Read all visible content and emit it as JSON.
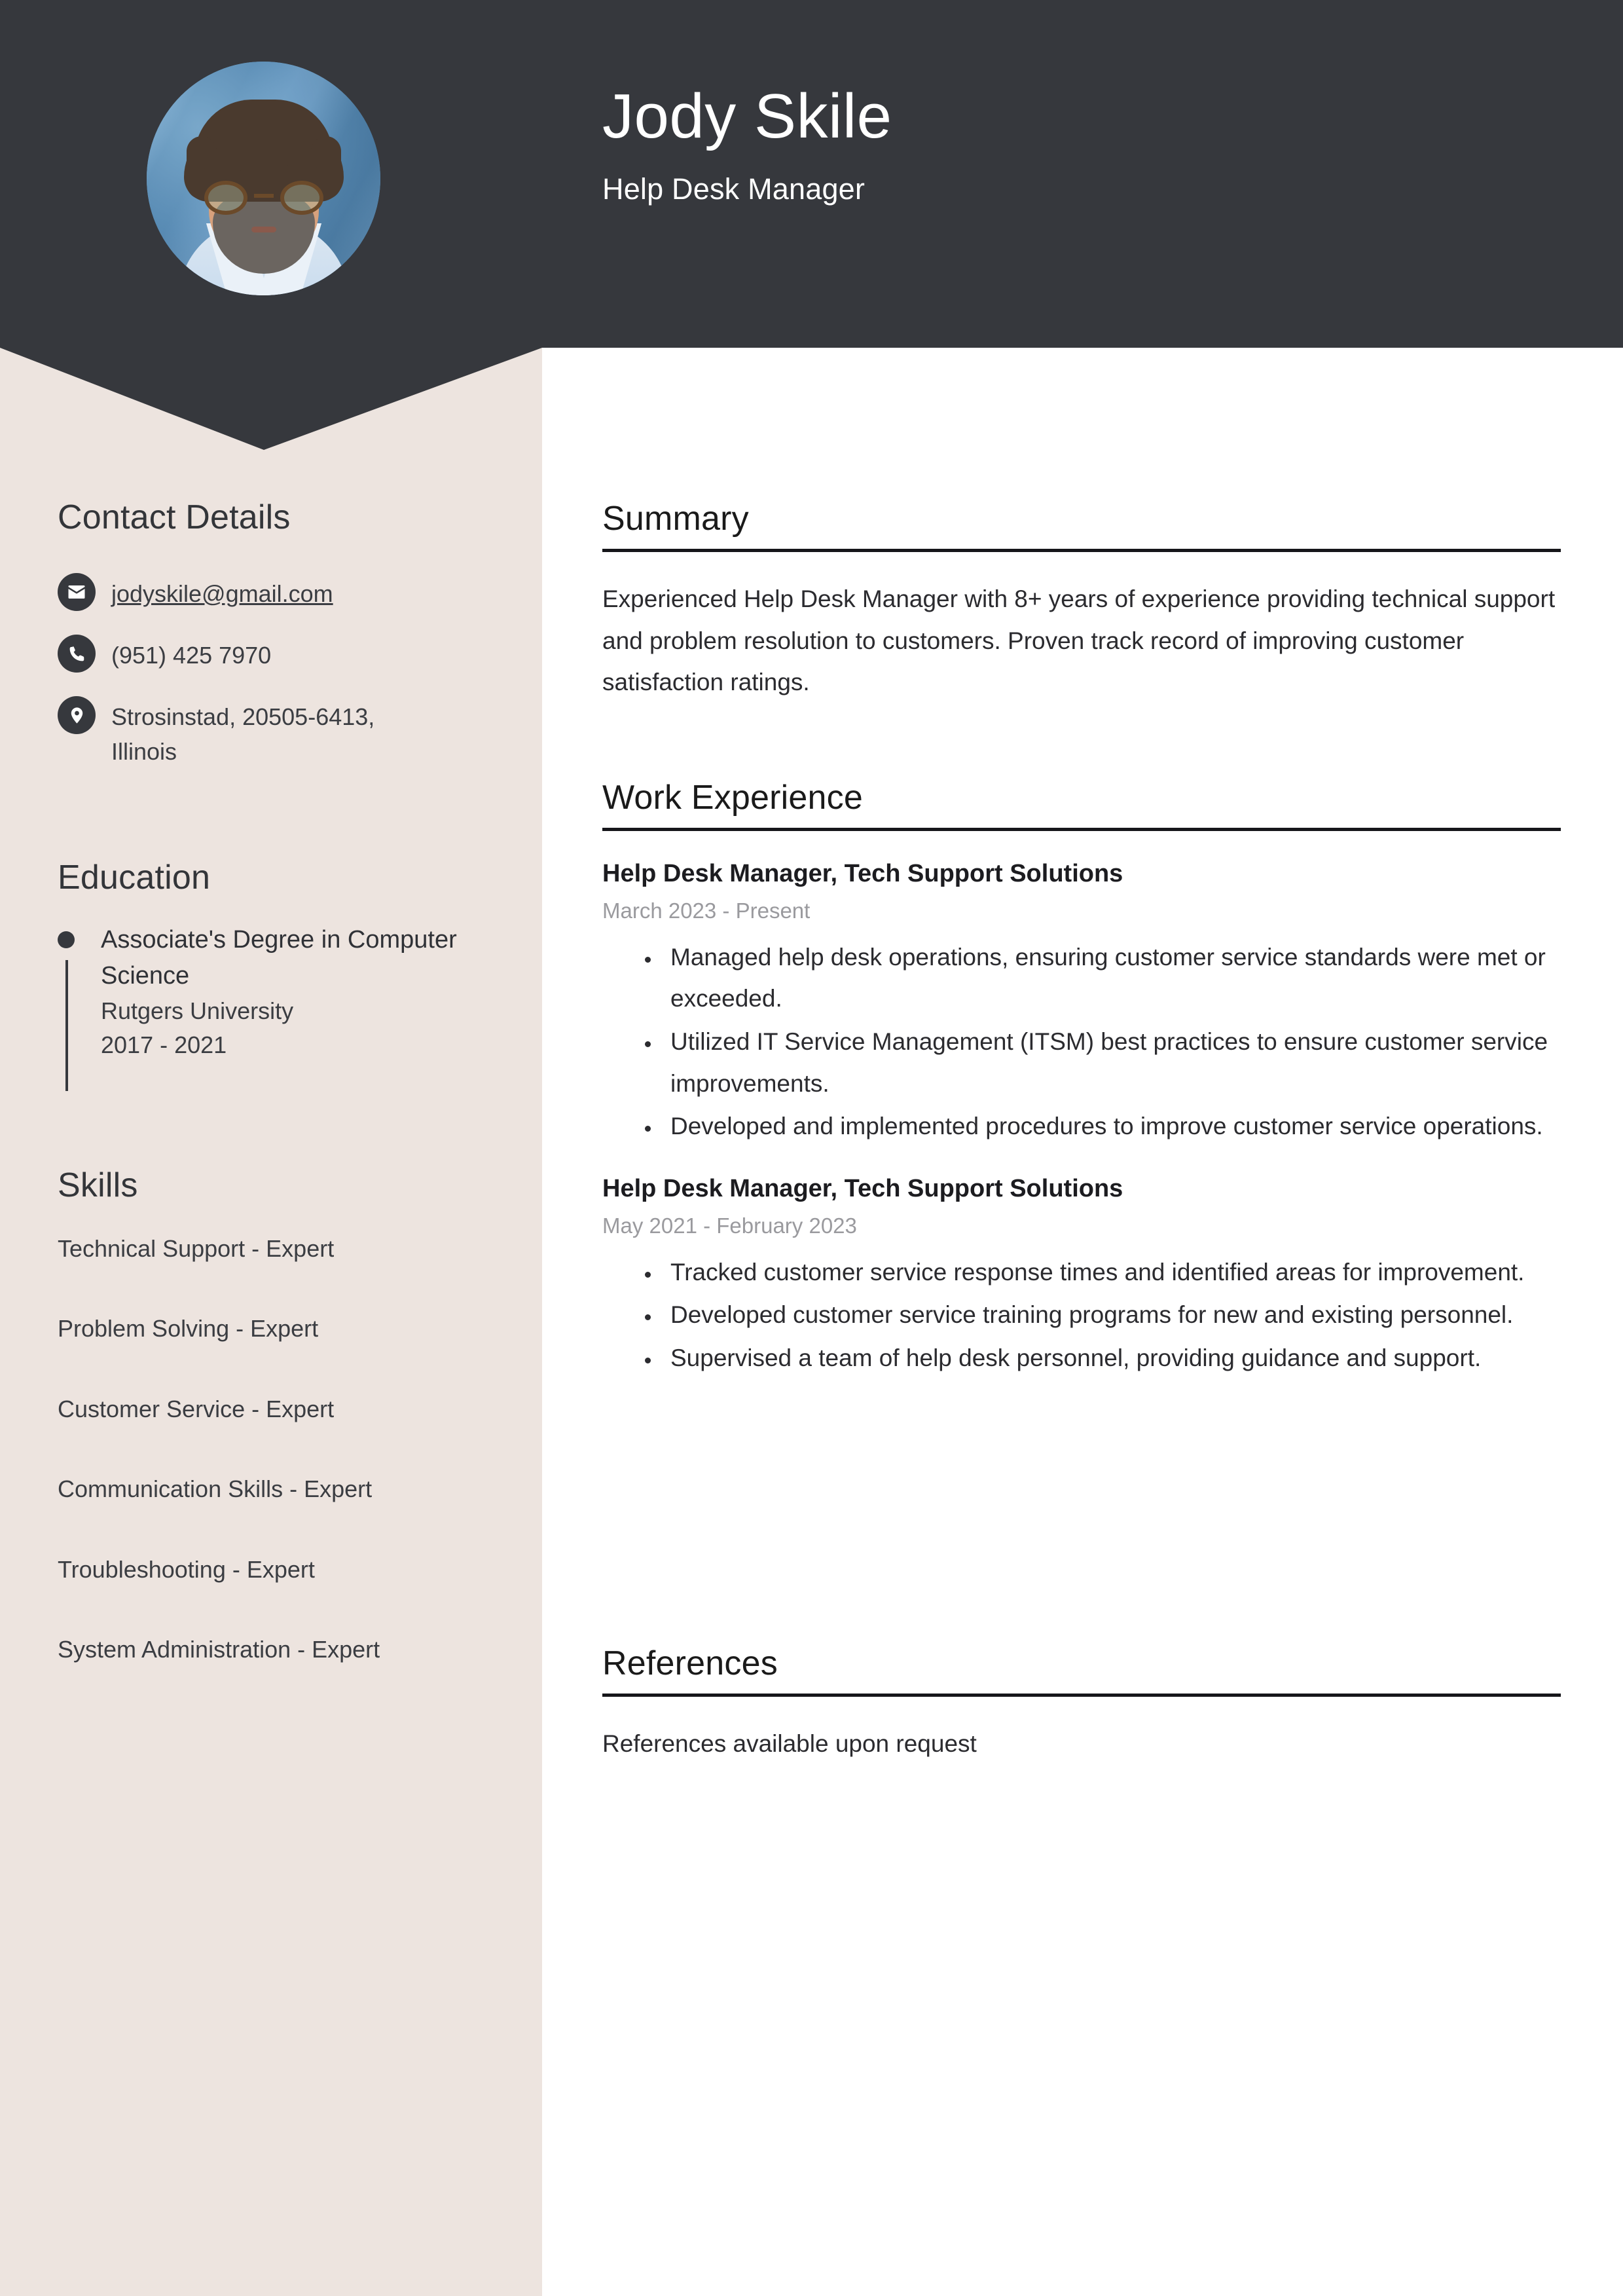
{
  "colors": {
    "header_dark": "#36383D",
    "sidebar_beige": "#EDE4DF",
    "body_text": "#2B2B2F",
    "muted_text": "#9A9A9E",
    "page_white": "#FFFFFF"
  },
  "header": {
    "full_name": "Jody Skile",
    "job_title": "Help Desk Manager",
    "avatar_alt": "portrait-photo"
  },
  "sidebar": {
    "contact": {
      "heading": "Contact Details",
      "items": [
        {
          "icon": "envelope-icon",
          "value": "jodyskile@gmail.com",
          "underlined": true
        },
        {
          "icon": "phone-icon",
          "value": "(951) 425 7970",
          "underlined": false
        },
        {
          "icon": "map-pin-icon",
          "value": "Strosinstad, 20505-6413, Illinois",
          "underlined": false
        }
      ]
    },
    "education": {
      "heading": "Education",
      "items": [
        {
          "degree": "Associate's Degree in Computer Science",
          "school": "Rutgers University",
          "dates": "2017 - 2021"
        }
      ]
    },
    "skills": {
      "heading": "Skills",
      "items": [
        "Technical Support - Expert",
        "Problem Solving - Expert",
        "Customer Service - Expert",
        "Communication Skills - Expert",
        "Troubleshooting - Expert",
        "System Administration - Expert"
      ]
    }
  },
  "main": {
    "summary": {
      "heading": "Summary",
      "text": "Experienced Help Desk Manager with 8+ years of experience providing technical support and problem resolution to customers. Proven track record of improving customer satisfaction ratings."
    },
    "work_experience": {
      "heading": "Work Experience",
      "jobs": [
        {
          "title": "Help Desk Manager, Tech Support Solutions",
          "dates": "March 2023 - Present",
          "bullets": [
            "Managed help desk operations, ensuring customer service standards were met or exceeded.",
            "Utilized IT Service Management (ITSM) best practices to ensure customer service improvements.",
            "Developed and implemented procedures to improve customer service operations."
          ]
        },
        {
          "title": "Help Desk Manager, Tech Support Solutions",
          "dates": "May 2021 - February 2023",
          "bullets": [
            "Tracked customer service response times and identified areas for improvement.",
            "Developed customer service training programs for new and existing personnel.",
            "Supervised a team of help desk personnel, providing guidance and support."
          ]
        }
      ]
    },
    "references": {
      "heading": "References",
      "text": "References available upon request"
    }
  }
}
